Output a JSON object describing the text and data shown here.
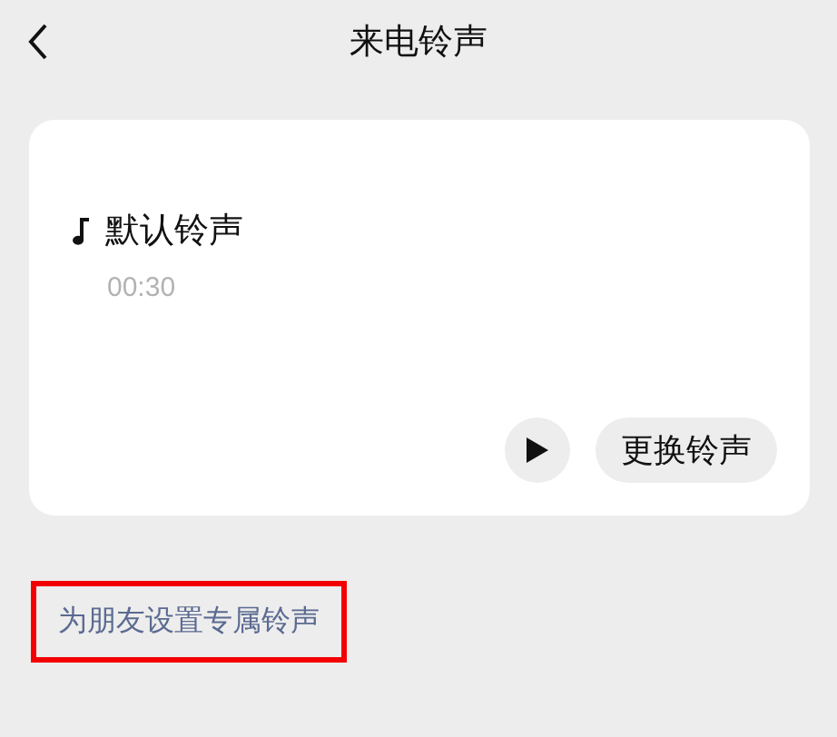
{
  "header": {
    "title": "来电铃声"
  },
  "ringtone": {
    "name": "默认铃声",
    "duration": "00:30",
    "change_button": "更换铃声"
  },
  "friend_link": {
    "label": "为朋友设置专属铃声",
    "highlighted": true
  }
}
